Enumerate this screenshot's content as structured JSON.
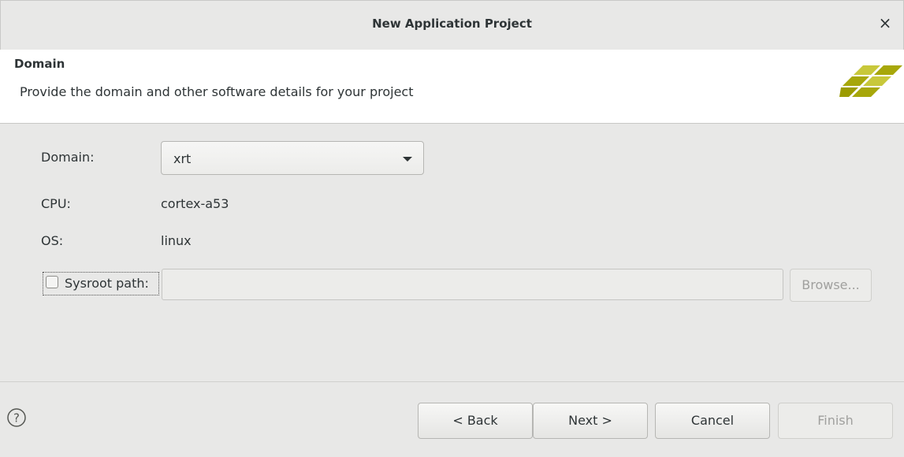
{
  "window": {
    "title": "New Application Project",
    "close_glyph": "×"
  },
  "header": {
    "title": "Domain",
    "description": "Provide the domain and other software details for your project",
    "logo_colors": [
      "#c5c533",
      "#a8a800",
      "#9a9a00"
    ]
  },
  "form": {
    "domain_label": "Domain:",
    "domain_value": "xrt",
    "cpu_label": "CPU:",
    "cpu_value": "cortex-a53",
    "os_label": "OS:",
    "os_value": "linux",
    "sysroot_label": "Sysroot path:",
    "sysroot_checked": false,
    "sysroot_value": "",
    "browse_label": "Browse..."
  },
  "footer": {
    "help_icon": "help-icon",
    "back_label": "< Back",
    "next_label": "Next >",
    "cancel_label": "Cancel",
    "finish_label": "Finish"
  }
}
